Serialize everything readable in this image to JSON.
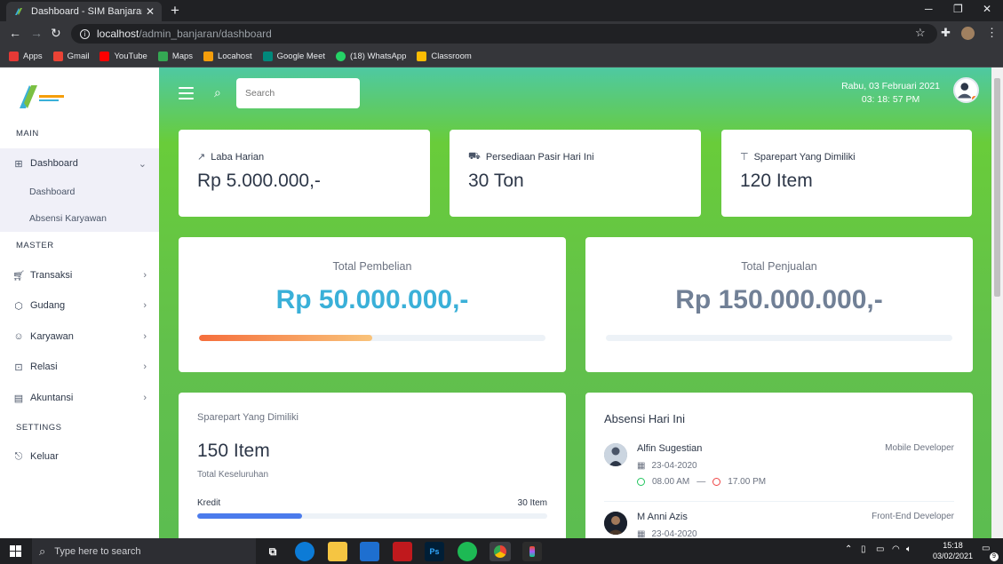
{
  "browser": {
    "tab_title": "Dashboard - SIM Banjaran Global",
    "new_tab": "+",
    "url_host": "localhost",
    "url_path": "/admin_banjaran/dashboard",
    "bookmarks": [
      {
        "label": "Apps",
        "color": "#e53935"
      },
      {
        "label": "Gmail",
        "color": "#ea4335"
      },
      {
        "label": "YouTube",
        "color": "#ff0000"
      },
      {
        "label": "Maps",
        "color": "#34a853"
      },
      {
        "label": "Locahost",
        "color": "#f59e0b"
      },
      {
        "label": "Google Meet",
        "color": "#00897b"
      },
      {
        "label": "(18) WhatsApp",
        "color": "#25d366"
      },
      {
        "label": "Classroom",
        "color": "#fbbc04"
      }
    ]
  },
  "sidebar": {
    "sections": {
      "main": "MAIN",
      "master": "MASTER",
      "settings": "SETTINGS"
    },
    "dashboard": "Dashboard",
    "sub_items": [
      "Dashboard",
      "Absensi Karyawan"
    ],
    "master_items": [
      "Transaksi",
      "Gudang",
      "Karyawan",
      "Relasi",
      "Akuntansi"
    ],
    "logout": "Keluar"
  },
  "header": {
    "search_placeholder": "Search",
    "date": "Rabu, 03 Februari 2021",
    "time": "03: 18: 57 PM"
  },
  "stats": [
    {
      "label": "Laba Harian",
      "value": "Rp 5.000.000,-",
      "icon": "trend-up-icon"
    },
    {
      "label": "Persediaan Pasir Hari Ini",
      "value": "30 Ton",
      "icon": "truck-icon"
    },
    {
      "label": "Sparepart Yang Dimiliki",
      "value": "120 Item",
      "icon": "wrench-icon"
    }
  ],
  "pembelian": {
    "title": "Total Pembelian",
    "value": "Rp 50.000.000,-",
    "progress": 0.5,
    "color": "#3ab0d8"
  },
  "penjualan": {
    "title": "Total Penjualan",
    "value": "Rp 150.000.000,-",
    "progress": 0,
    "color": "#718096"
  },
  "sparepart": {
    "title": "Sparepart Yang Dimiliki",
    "value": "150 Item",
    "sub": "Total Keseluruhan",
    "rows": [
      {
        "label": "Kredit",
        "value": "30 Item",
        "progress": 0.3
      }
    ]
  },
  "absensi": {
    "title": "Absensi Hari Ini",
    "items": [
      {
        "name": "Alfin Sugestian",
        "role": "Mobile Developer",
        "date": "23-04-2020",
        "in": "08.00 AM",
        "sep": "—",
        "out": "17.00 PM"
      },
      {
        "name": "M Anni Azis",
        "role": "Front-End Developer",
        "date": "23-04-2020"
      }
    ]
  },
  "taskbar": {
    "search_placeholder": "Type here to search",
    "time": "15:18",
    "date": "03/02/2021",
    "notif": "9"
  }
}
